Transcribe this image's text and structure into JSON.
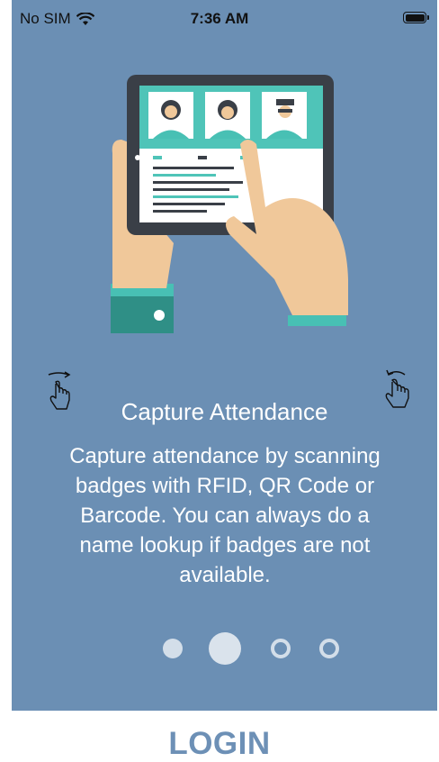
{
  "status_bar": {
    "carrier": "No SIM",
    "time": "7:36 AM"
  },
  "onboarding": {
    "title": "Capture Attendance",
    "description": "Capture attendance by scanning badges with RFID, QR Code or Barcode. You can always do a name lookup if badges are not available.",
    "page_index": 2,
    "page_count": 4
  },
  "login_label": "LOGIN",
  "colors": {
    "background": "#6b8fb4",
    "login": "#6d90b6"
  }
}
